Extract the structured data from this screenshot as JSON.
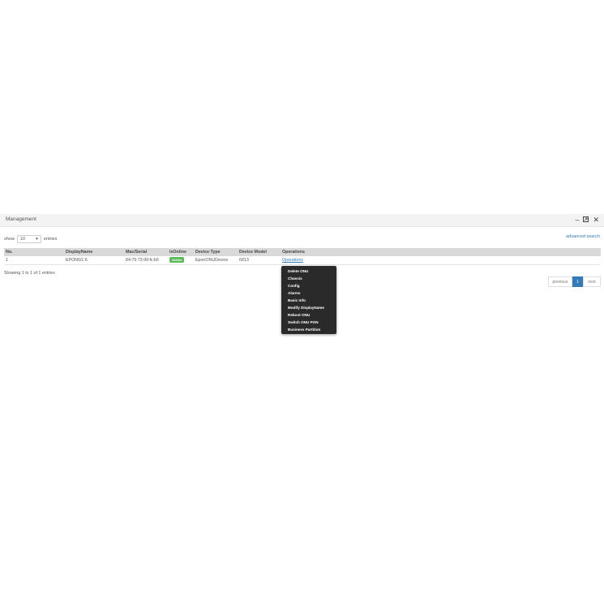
{
  "window": {
    "title": "Management",
    "controls": [
      "minimize-icon",
      "maximize-icon",
      "close-icon"
    ]
  },
  "controls": {
    "show_label": "show",
    "page_size": "10",
    "entries_label": "entries",
    "advanced_search": "advanced search"
  },
  "table": {
    "columns": [
      "No.",
      "DisplayName",
      "Mac/Serial",
      "IsOnline",
      "Device Type",
      "Device Model",
      "Operations"
    ],
    "rows": [
      {
        "no": "1",
        "display_name": "EPON0/1:6",
        "mac": "84:79:73:99:fc:b5",
        "online": "Online",
        "device_type": "EponONUDevice",
        "device_model": "6813",
        "operations": "Operations"
      }
    ]
  },
  "footer": {
    "showing": "Showing 1 to 1 of 1 entries"
  },
  "pagination": {
    "previous": "previous",
    "current": "1",
    "next": "next"
  },
  "menu": {
    "items": [
      "Delete ONU",
      "Chassis",
      "Config",
      "Alarms",
      "Basic Info",
      "Modify DisplayName",
      "Reboot ONU",
      "Switch ONU PON",
      "Business Partition"
    ]
  },
  "colors": {
    "accent": "#337ab7",
    "online": "#5cb85c",
    "menu_bg": "#2a2a2a",
    "header_bg": "#d9d9d9"
  }
}
